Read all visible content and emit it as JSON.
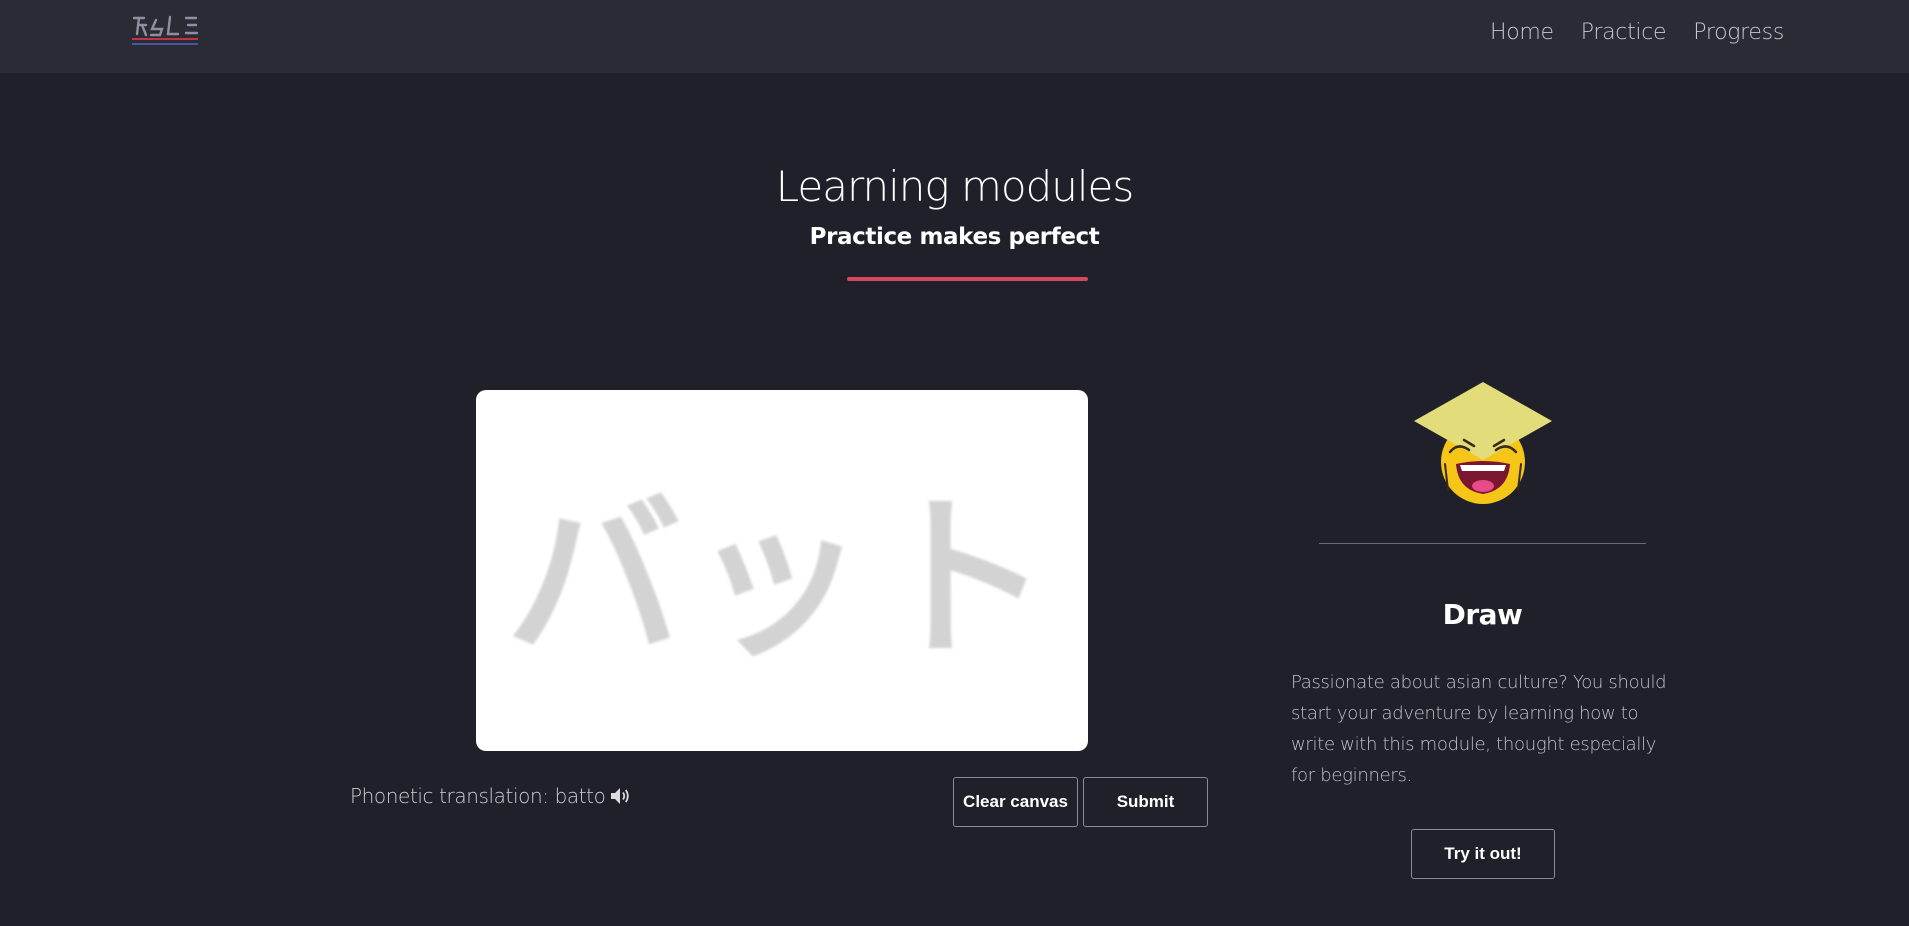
{
  "nav": {
    "logo_text": "ASLE",
    "links": [
      "Home",
      "Practice",
      "Progress"
    ]
  },
  "header": {
    "title": "Learning modules",
    "subtitle": "Practice makes perfect"
  },
  "canvas": {
    "guide_text": "バット"
  },
  "phonetic": {
    "label": "Phonetic translation:",
    "value": "batto"
  },
  "buttons": {
    "clear": "Clear canvas",
    "submit": "Submit",
    "try": "Try it out!"
  },
  "module": {
    "title": "Draw",
    "description": "Passionate about asian culture? You should start your adventure by learning how to write with this module, thought especially for beginners."
  },
  "icons": {
    "speaker": "speaker-icon",
    "mascot": "mascot-icon"
  },
  "colors": {
    "background": "#1f2029",
    "navbar": "#2a2b34",
    "accent": "#d4475e"
  }
}
